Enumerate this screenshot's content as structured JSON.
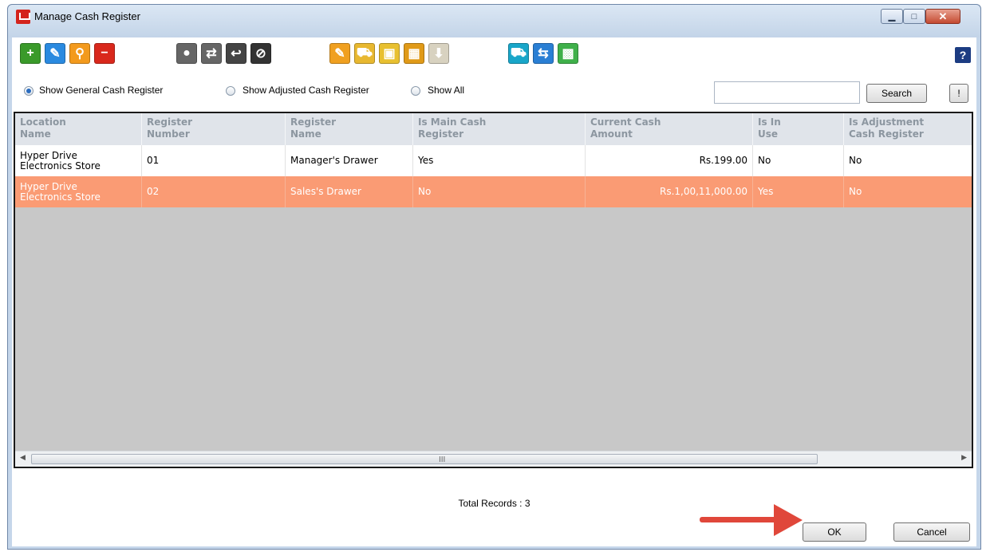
{
  "window": {
    "title": "Manage Cash Register",
    "min_glyph": "▁",
    "max_glyph": "□",
    "close_glyph": "✕"
  },
  "toolbar": {
    "groups": [
      [
        {
          "name": "add-button",
          "icon": "plus-icon",
          "glyph": "+",
          "color": "#3a9a2a"
        },
        {
          "name": "edit-button",
          "icon": "pencil-icon",
          "glyph": "✎",
          "color": "#2a8ae0"
        },
        {
          "name": "search-button",
          "icon": "magnifier-icon",
          "glyph": "⚲",
          "color": "#f39a1d"
        },
        {
          "name": "delete-button",
          "icon": "minus-icon",
          "glyph": "−",
          "color": "#d9281c"
        }
      ],
      [
        {
          "name": "coins-button",
          "icon": "coins-icon",
          "glyph": "●",
          "color": "#666666"
        },
        {
          "name": "transfer-button",
          "icon": "arrows-swap-icon",
          "glyph": "⇄",
          "color": "#666666"
        },
        {
          "name": "refund-button",
          "icon": "coin-arrow-icon",
          "glyph": "↩",
          "color": "#444444"
        },
        {
          "name": "void-button",
          "icon": "prohibited-icon",
          "glyph": "⊘",
          "color": "#333333"
        }
      ],
      [
        {
          "name": "notes-button",
          "icon": "notepad-icon",
          "glyph": "✎",
          "color": "#f0a020"
        },
        {
          "name": "cart-button",
          "icon": "cart-icon",
          "glyph": "⛟",
          "color": "#e8b830"
        },
        {
          "name": "stock-button",
          "icon": "box-arrow-icon",
          "glyph": "▣",
          "color": "#e8c030"
        },
        {
          "name": "calendar-button",
          "icon": "calendar-icon",
          "glyph": "▦",
          "color": "#e09a18"
        },
        {
          "name": "import-button",
          "icon": "download-box-icon",
          "glyph": "⬇",
          "color": "#d8d2c0"
        }
      ],
      [
        {
          "name": "delivery-button",
          "icon": "truck-icon",
          "glyph": "⛟",
          "color": "#19a6c9"
        },
        {
          "name": "return-button",
          "icon": "return-truck-icon",
          "glyph": "⇆",
          "color": "#2a7fd4"
        },
        {
          "name": "package-button",
          "icon": "package-icon",
          "glyph": "▩",
          "color": "#3fb04a"
        }
      ]
    ],
    "help_glyph": "?"
  },
  "filters": {
    "options": [
      {
        "label": "Show General Cash Register",
        "checked": true
      },
      {
        "label": "Show Adjusted Cash Register",
        "checked": false
      },
      {
        "label": "Show All",
        "checked": false
      }
    ],
    "search_value": "",
    "search_label": "Search",
    "alert_label": "!"
  },
  "grid": {
    "columns": [
      "Location\nName",
      "Register\nNumber",
      "Register\nName",
      "Is Main Cash\nRegister",
      "Current Cash\nAmount",
      "Is In\nUse",
      "Is Adjustment\nCash Register"
    ],
    "rows": [
      [
        "Hyper Drive\nElectronics Store",
        "01",
        "Manager's Drawer",
        "Yes",
        "Rs.199.00",
        "No",
        "No"
      ],
      [
        "Hyper Drive\nElectronics Store",
        "02",
        "Sales's Drawer",
        "No",
        "Rs.1,00,11,000.00",
        "Yes",
        "No"
      ]
    ],
    "selected_row_index": 1,
    "selected_color": "#fa9b74",
    "scroll_grip": "III"
  },
  "footer": {
    "total_records": "Total Records : 3",
    "ok_label": "OK",
    "cancel_label": "Cancel",
    "annotation_arrow_color": "#e0473a"
  }
}
